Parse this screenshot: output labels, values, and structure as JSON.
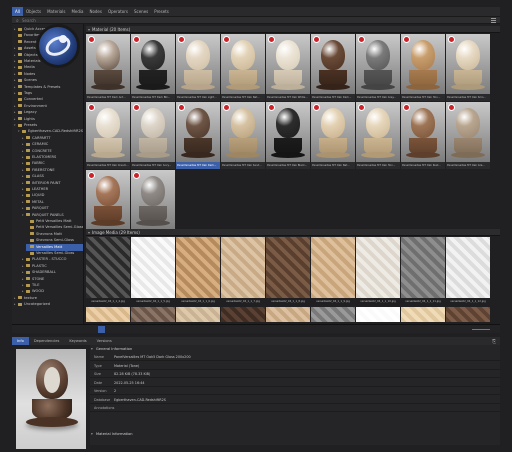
{
  "top_tabs": [
    {
      "label": "All",
      "active": true
    },
    {
      "label": "Objects",
      "active": false
    },
    {
      "label": "Materials",
      "active": false
    },
    {
      "label": "Media",
      "active": false
    },
    {
      "label": "Nodes",
      "active": false
    },
    {
      "label": "Operators",
      "active": false
    },
    {
      "label": "Scenes",
      "active": false
    },
    {
      "label": "Presets",
      "active": false
    }
  ],
  "search": {
    "placeholder": "Search"
  },
  "tree": [
    {
      "label": "Quick Access",
      "depth": 1,
      "expand": "▸"
    },
    {
      "label": "Favorites",
      "depth": 1,
      "expand": ""
    },
    {
      "label": "Recent",
      "depth": 1,
      "expand": ""
    },
    {
      "label": "Assets",
      "depth": 1,
      "expand": "▸"
    },
    {
      "label": "Objects",
      "depth": 1,
      "expand": "▸"
    },
    {
      "label": "Materials",
      "depth": 1,
      "expand": "▸"
    },
    {
      "label": "Media",
      "depth": 1,
      "expand": "▸"
    },
    {
      "label": "Nodes",
      "depth": 1,
      "expand": "▸"
    },
    {
      "label": "Scenes",
      "depth": 1,
      "expand": "▸"
    },
    {
      "label": "Templates & Presets",
      "depth": 1,
      "expand": "▸"
    },
    {
      "label": "Tags",
      "depth": 1,
      "expand": "▸"
    },
    {
      "label": "Converted",
      "depth": 1,
      "expand": ""
    },
    {
      "label": "Environment",
      "depth": 1,
      "expand": "▸"
    },
    {
      "label": "Legacy",
      "depth": 1,
      "expand": "▸"
    },
    {
      "label": "Lights",
      "depth": 1,
      "expand": "▸"
    },
    {
      "label": "Presets",
      "depth": 1,
      "expand": "▾"
    },
    {
      "label": "Egberthaven-CAD-RedshiftR2S",
      "depth": 2,
      "expand": "▾"
    },
    {
      "label": "CARPARTT",
      "depth": 3,
      "expand": "▸"
    },
    {
      "label": "CERAMIC",
      "depth": 3,
      "expand": "▸"
    },
    {
      "label": "CONCRETE",
      "depth": 3,
      "expand": "▸"
    },
    {
      "label": "ELASTOMERS",
      "depth": 3,
      "expand": "▸"
    },
    {
      "label": "FABRIC",
      "depth": 3,
      "expand": "▸"
    },
    {
      "label": "FIBERSTONE",
      "depth": 3,
      "expand": "▸"
    },
    {
      "label": "GLASS",
      "depth": 3,
      "expand": "▸"
    },
    {
      "label": "INTERIOR PAINT",
      "depth": 3,
      "expand": "▸"
    },
    {
      "label": "LEATHER",
      "depth": 3,
      "expand": "▸"
    },
    {
      "label": "LIQUID",
      "depth": 3,
      "expand": "▸"
    },
    {
      "label": "METAL",
      "depth": 3,
      "expand": "▸"
    },
    {
      "label": "PARQUET",
      "depth": 3,
      "expand": "▸"
    },
    {
      "label": "PARQUET PANELS",
      "depth": 3,
      "expand": "▾"
    },
    {
      "label": "Petit Versailles Matt",
      "depth": 4,
      "expand": ""
    },
    {
      "label": "Petit Versailles Semi-Gloss",
      "depth": 4,
      "expand": ""
    },
    {
      "label": "Shevrons Matt",
      "depth": 4,
      "expand": ""
    },
    {
      "label": "Shevrons Semi-Gloss",
      "depth": 4,
      "expand": ""
    },
    {
      "label": "Versailles Matt",
      "depth": 4,
      "expand": "",
      "selected": true
    },
    {
      "label": "Versailles Semi-Gloss",
      "depth": 4,
      "expand": ""
    },
    {
      "label": "PLASTER - STUCCO",
      "depth": 3,
      "expand": "▸"
    },
    {
      "label": "PLASTIC",
      "depth": 3,
      "expand": "▸"
    },
    {
      "label": "SHADERBALL",
      "depth": 3,
      "expand": "▸"
    },
    {
      "label": "STONE",
      "depth": 3,
      "expand": "▸"
    },
    {
      "label": "TILE",
      "depth": 3,
      "expand": "▸"
    },
    {
      "label": "WOOD",
      "depth": 3,
      "expand": "▸"
    },
    {
      "label": "texture",
      "depth": 1,
      "expand": "▸"
    },
    {
      "label": "Uncategorized",
      "depth": 1,
      "expand": "▸"
    }
  ],
  "material_section": {
    "title": "Material (20 Items)"
  },
  "materials": [
    {
      "label": "PanelVersailles MT Dark Ant...",
      "ball": "#b8a89a",
      "stand": "#5a4a3e",
      "base": "#3d3129"
    },
    {
      "label": "PanelVersailles MT Dark Blk...",
      "ball": "#3a3a3a",
      "stand": "#222",
      "base": "#1a1a1a"
    },
    {
      "label": "PanelVersailles MT Oak Light...",
      "ball": "#e4d7c3",
      "stand": "#cdbda4",
      "base": "#b7a48a"
    },
    {
      "label": "PanelVersailles MT Oak Nat...",
      "ball": "#e2d2b6",
      "stand": "#c9b493",
      "base": "#b09a78"
    },
    {
      "label": "PanelVersailles MT Oak White...",
      "ball": "#ece4d6",
      "stand": "#d5cab6",
      "base": "#bdb09a"
    },
    {
      "label": "PanelVersailles MT Oak Dark...",
      "ball": "#6b4b38",
      "stand": "#4a3122",
      "base": "#35231a"
    },
    {
      "label": "PanelVersailles MT Oak Grey...",
      "ball": "#7a7a7a",
      "stand": "#555",
      "base": "#444"
    },
    {
      "label": "PanelVersailles MT Oak Hon...",
      "ball": "#c99e6d",
      "stand": "#a77b4e",
      "base": "#8c643d"
    },
    {
      "label": "PanelVersailles MT Oak Smo...",
      "ball": "#e7dac4",
      "stand": "#c7b596",
      "base": "#ad9a7a"
    },
    {
      "label": "PanelVersailles MT Oak Cream...",
      "ball": "#e8e0d2",
      "stand": "#d2c4ae",
      "base": "#b9a98f"
    },
    {
      "label": "PanelVersailles MT Oak Ivory...",
      "ball": "#ddd5c9",
      "stand": "#c0b4a3",
      "base": "#a89b88"
    },
    {
      "label": "PanelVersailles MT Oak Dark...",
      "ball": "#6e5546",
      "stand": "#4b372a",
      "base": "#37271e",
      "selected": true
    },
    {
      "label": "PanelVersailles MT Oak Sand...",
      "ball": "#d6c2a2",
      "stand": "#b8a07b",
      "base": "#9e8663"
    },
    {
      "label": "PanelVersailles MT Oak Black...",
      "ball": "#2d2d2d",
      "stand": "#1c1c1c",
      "base": "#141414"
    },
    {
      "label": "PanelVersailles MT Oak Nat...",
      "ball": "#e3d1b3",
      "stand": "#c6ae8a",
      "base": "#ac936f"
    },
    {
      "label": "PanelVersailles MT Oak Hon...",
      "ball": "#e6d6bb",
      "stand": "#cbb591",
      "base": "#b19a75"
    },
    {
      "label": "PanelVersailles MT Oak Rust...",
      "ball": "#9e7556",
      "stand": "#7a543a",
      "base": "#5e3f2b"
    },
    {
      "label": "PanelVersailles MT Oak Gra...",
      "ball": "#b9a690",
      "stand": "#9a8670",
      "base": "#7f6c57"
    },
    {
      "label": "PanelVersailles MT Dark Vin...",
      "ball": "#a6775a",
      "stand": "#7b5138",
      "base": "#5c3b27"
    },
    {
      "label": "PanelVersailles MT Dark Vin...",
      "ball": "#8f8a86",
      "stand": "#6e6864",
      "base": "#55504c"
    }
  ],
  "image_section": {
    "title": "Image Media (29 Items)"
  },
  "textures": [
    {
      "label": "versailles02_04_1_1_4.jpg",
      "c1": "#2a2a2a",
      "c2": "#555"
    },
    {
      "label": "versailles02_04_1_1_5.jpg",
      "c1": "#e8e8e8",
      "c2": "#fafafa"
    },
    {
      "label": "versailles02_04_1_1_6.jpg",
      "c1": "#b58a5c",
      "c2": "#d6ae80"
    },
    {
      "label": "versailles02_04_1_1_7.jpg",
      "c1": "#c8aa86",
      "c2": "#ddc4a4"
    },
    {
      "label": "versailles02_04_1_1_8.jpg",
      "c1": "#5a3f2e",
      "c2": "#7a5b45"
    },
    {
      "label": "versailles02_04_1_1_9.jpg",
      "c1": "#c9a57c",
      "c2": "#dec09c"
    },
    {
      "label": "versailles02_04_1_1_10.jpg",
      "c1": "#ddd6cc",
      "c2": "#eeeae4"
    },
    {
      "label": "versailles02_04_1_1_11.jpg",
      "c1": "#6f6f6f",
      "c2": "#8e8e8e"
    },
    {
      "label": "versailles02_04_1_1_12.jpg",
      "c1": "#dcdcdc",
      "c2": "#f2f2f2"
    },
    {
      "label": "",
      "c1": "#d9b98c",
      "c2": "#eccfa6"
    },
    {
      "label": "",
      "c1": "#6a5548",
      "c2": "#8a7466"
    },
    {
      "label": "",
      "c1": "#c9b394",
      "c2": "#ddc8aa"
    },
    {
      "label": "",
      "c1": "#3f2c22",
      "c2": "#5a4133"
    },
    {
      "label": "",
      "c1": "#c7a882",
      "c2": "#dcc0a0"
    },
    {
      "label": "",
      "c1": "#7a7a7a",
      "c2": "#9a9a9a"
    },
    {
      "label": "",
      "c1": "#fafafa",
      "c2": "#ffffff"
    },
    {
      "label": "",
      "c1": "#e0c79e",
      "c2": "#f0dbb8"
    },
    {
      "label": "",
      "c1": "#5e4232",
      "c2": "#7c5c48"
    }
  ],
  "info_tabs": [
    {
      "label": "Info",
      "active": true
    },
    {
      "label": "Dependencies",
      "active": false
    },
    {
      "label": "Keywords",
      "active": false
    },
    {
      "label": "Versions",
      "active": false
    }
  ],
  "info": {
    "general_title": "General Information",
    "rows": [
      {
        "key": "Name",
        "value": "PanelVersailles MT Oak5 Dark Gloss 200x200"
      },
      {
        "key": "Type",
        "value": "Material (Tone)"
      },
      {
        "key": "Size",
        "value": "82.28 KiB (78.33 KiB)"
      },
      {
        "key": "Date",
        "value": "2022-05-25 16:44"
      },
      {
        "key": "Version",
        "value": "2"
      },
      {
        "key": "Database",
        "value": "Egberthaven-CAD-RedshiftR2S"
      },
      {
        "key": "Annotations",
        "value": ""
      }
    ],
    "material_title": "Material Information"
  },
  "colors": {
    "accent": "#3b5fa8",
    "badge": "#c9232b"
  },
  "icons": {
    "search": "search-icon",
    "menu": "menu-icon",
    "grid": "grid-view-icon",
    "logo": "cinema4d-logo-icon"
  }
}
